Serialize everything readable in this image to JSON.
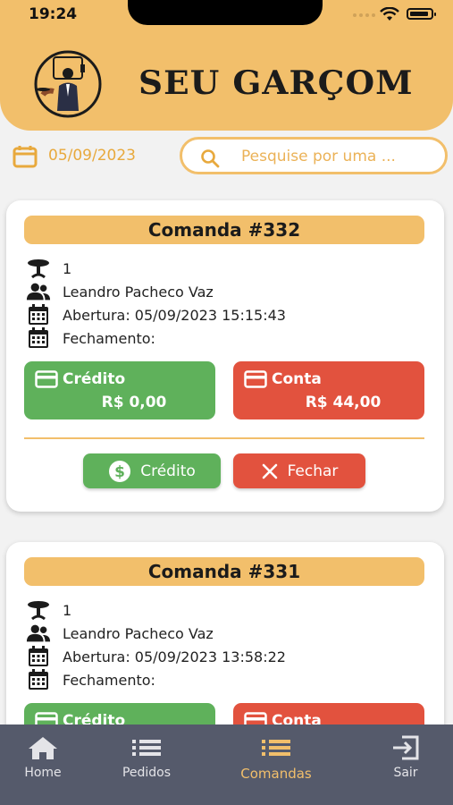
{
  "status_bar": {
    "time": "19:24"
  },
  "header": {
    "brand": "SEU GARÇOM"
  },
  "filters": {
    "date": "05/09/2023",
    "search_placeholder": "Pesquise por uma ..."
  },
  "comandas": [
    {
      "title": "Comanda #332",
      "mesa": "1",
      "cliente": "Leandro Pacheco Vaz",
      "abertura": "Abertura: 05/09/2023 15:15:43",
      "fechamento": "Fechamento:",
      "credito_label": "Crédito",
      "credito_valor": "R$ 0,00",
      "conta_label": "Conta",
      "conta_valor": "R$ 44,00",
      "btn_credito": "Crédito",
      "btn_fechar": "Fechar"
    },
    {
      "title": "Comanda #331",
      "mesa": "1",
      "cliente": "Leandro Pacheco Vaz",
      "abertura": "Abertura: 05/09/2023 13:58:22",
      "fechamento": "Fechamento:",
      "credito_label": "Crédito",
      "conta_label": "Conta"
    }
  ],
  "tabbar": {
    "items": [
      {
        "label": "Home",
        "icon": "home-icon"
      },
      {
        "label": "Pedidos",
        "icon": "list-icon"
      },
      {
        "label": "Comandas",
        "icon": "list-icon",
        "active": true
      },
      {
        "label": "Sair",
        "icon": "exit-icon"
      }
    ]
  },
  "colors": {
    "accent": "#f2bf6b",
    "green": "#5fb15b",
    "red": "#e2523e",
    "tabbar": "#555a6b"
  }
}
